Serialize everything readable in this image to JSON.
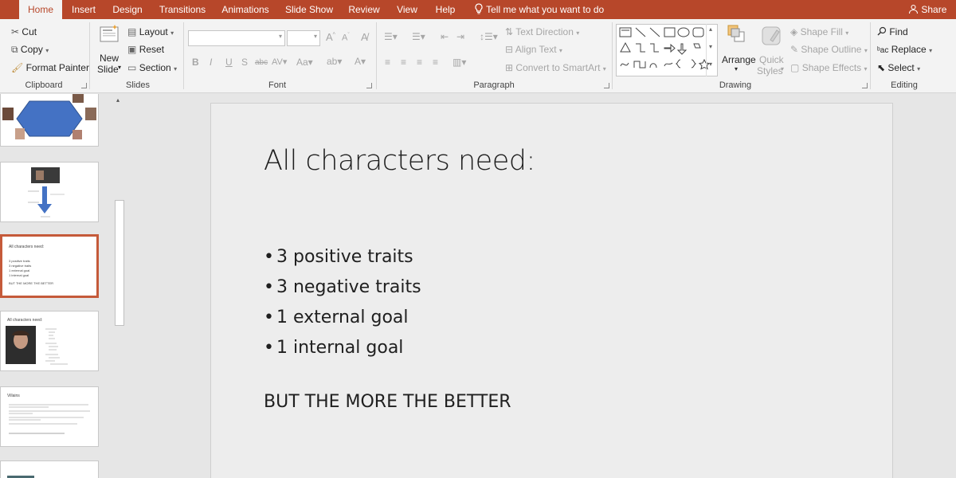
{
  "tabs": [
    "Home",
    "Insert",
    "Design",
    "Transitions",
    "Animations",
    "Slide Show",
    "Review",
    "View",
    "Help"
  ],
  "tell_me": "Tell me what you want to do",
  "share": "Share",
  "clipboard": {
    "cut": "Cut",
    "copy": "Copy",
    "format_painter": "Format Painter",
    "label": "Clipboard"
  },
  "slides_group": {
    "new_slide_1": "New",
    "new_slide_2": "Slide",
    "layout": "Layout",
    "reset": "Reset",
    "section": "Section",
    "label": "Slides"
  },
  "font_group": {
    "label": "Font"
  },
  "paragraph_group": {
    "text_direction": "Text Direction",
    "align_text": "Align Text",
    "convert_smartart": "Convert to SmartArt",
    "label": "Paragraph"
  },
  "drawing_group": {
    "arrange": "Arrange",
    "quick_1": "Quick",
    "quick_2": "Styles",
    "shape_fill": "Shape Fill",
    "shape_outline": "Shape Outline",
    "shape_effects": "Shape Effects",
    "label": "Drawing"
  },
  "editing_group": {
    "find": "Find",
    "replace": "Replace",
    "select": "Select",
    "label": "Editing"
  },
  "thumbnails": {
    "t3": {
      "title": "All characters need:",
      "lines": [
        "3 positive traits",
        "3 negative traits",
        "1 external goal",
        "1 internal goal"
      ],
      "footer": "BUT THE MORE THE BETTER"
    },
    "t4": {
      "title": "All characters need:"
    },
    "t5": {
      "title": "Villains"
    }
  },
  "slide": {
    "title": "All characters need:",
    "bullets": [
      "3 positive traits",
      "3 negative traits",
      "1 external goal",
      "1 internal goal"
    ],
    "note": "BUT THE MORE THE BETTER"
  },
  "colors": {
    "accent": "#b7472a",
    "selected_thumb": "#c55a3a"
  }
}
